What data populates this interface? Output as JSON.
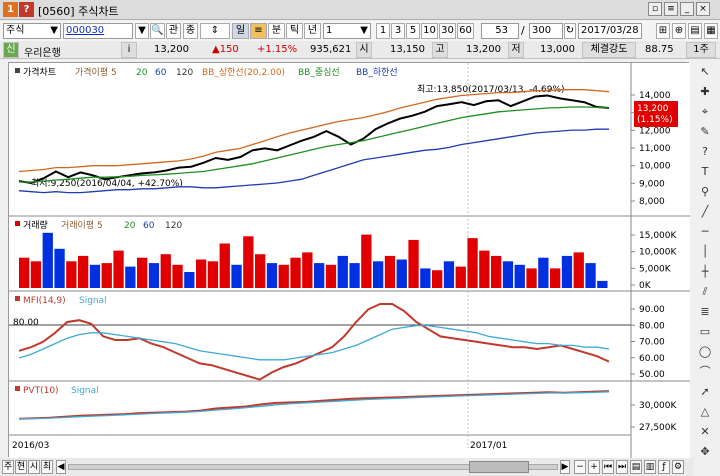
{
  "window": {
    "title": "[0560] 주식차트",
    "icons": {
      "num1": "1",
      "num2": "?"
    }
  },
  "toolbar": {
    "market": "주식",
    "code": "000030",
    "buttons": [
      "관",
      "종"
    ],
    "period_buttons": [
      "일",
      "주",
      "월",
      "분",
      "틱",
      "년"
    ],
    "minute_value": "1",
    "intervals": [
      "1",
      "3",
      "5",
      "10",
      "30",
      "60"
    ],
    "count_value": "53",
    "total_value": "300",
    "date_value": "2017/03/28"
  },
  "quote": {
    "badge": "신",
    "name": "우리은행",
    "info_icon": "i",
    "price": "13,200",
    "change": "▲150",
    "change_pct": "+1.15%",
    "volume": "935,621",
    "open_label": "시",
    "open": "13,150",
    "high_label": "고",
    "high": "13,200",
    "low_label": "저",
    "low": "13,000",
    "strength_label": "체결강도",
    "strength": "88.75",
    "unit": "1주"
  },
  "price_panel": {
    "legend": [
      "가격차트",
      "가격이평 5",
      "20",
      "60",
      "120",
      "BB_상한선(20,2.00)",
      "BB_중심선",
      "BB_하한선"
    ],
    "max_label": "최고:13,850(2017/03/13, -4.69%)",
    "min_label": "최저:9,250(2016/04/04, +42.70%)",
    "current_price": "13,200",
    "current_pct": "(1.15%)",
    "y_ticks": [
      "14,000",
      "13,000",
      "12,000",
      "11,000",
      "10,000",
      "9,000",
      "8,000"
    ]
  },
  "volume_panel": {
    "legend": [
      "거래량",
      "거래이평 5",
      "20",
      "60",
      "120"
    ],
    "y_ticks": [
      "15,000K",
      "10,000K",
      "5,000K",
      "0K"
    ]
  },
  "mfi_panel": {
    "legend": [
      "MFI(14,9)",
      "Signal"
    ],
    "level_label": "80.00",
    "y_ticks": [
      "90.00",
      "80.00",
      "70.00",
      "60.00",
      "50.00"
    ]
  },
  "pvt_panel": {
    "legend": [
      "PVT(10)",
      "Signal"
    ],
    "y_ticks": [
      "30,000K",
      "27,500K"
    ]
  },
  "x_axis": {
    "labels": [
      "2016/03",
      "2017/01"
    ]
  },
  "bottom": {
    "tabs": [
      "주",
      "현",
      "시",
      "최"
    ]
  },
  "colors": {
    "price_black": "#000000",
    "ma5": "#8b5a2b",
    "ma20": "#1f8f1f",
    "bb_upper": "#d2691e",
    "bb_lower": "#1e3cb4",
    "up": "#e00000",
    "down": "#0030e0",
    "mfi": "#c0392b",
    "signal": "#3fa9d6"
  },
  "chart_data": [
    {
      "type": "line",
      "title": "가격차트",
      "ylim": [
        8000,
        14500
      ],
      "series": [
        {
          "name": "가격차트",
          "values": [
            9400,
            9300,
            9550,
            9900,
            9600,
            9850,
            9700,
            9500,
            9600,
            9700,
            9800,
            9850,
            9950,
            10100,
            10150,
            10350,
            10600,
            10500,
            10650,
            11000,
            11100,
            11000,
            11250,
            11500,
            11700,
            12000,
            11700,
            11300,
            11600,
            12100,
            12400,
            12650,
            12800,
            13000,
            13300,
            13400,
            13500,
            13350,
            13550,
            13600,
            13300,
            13550,
            13800,
            13850,
            13700,
            13600,
            13500,
            13250,
            13200
          ]
        },
        {
          "name": "20",
          "values": [
            9350,
            9350,
            9400,
            9450,
            9500,
            9550,
            9600,
            9600,
            9620,
            9650,
            9700,
            9720,
            9760,
            9800,
            9850,
            9900,
            10000,
            10100,
            10200,
            10300,
            10450,
            10600,
            10750,
            10900,
            11050,
            11200,
            11300,
            11400,
            11500,
            11650,
            11800,
            11950,
            12100,
            12250,
            12400,
            12550,
            12700,
            12800,
            12900,
            13000,
            13050,
            13100,
            13150,
            13200,
            13220,
            13250,
            13250,
            13230,
            13200
          ]
        },
        {
          "name": "BB_상한선(20,2.00)",
          "values": [
            9900,
            9950,
            10000,
            10100,
            10100,
            10150,
            10200,
            10200,
            10200,
            10250,
            10300,
            10350,
            10400,
            10450,
            10550,
            10700,
            10900,
            11000,
            11100,
            11300,
            11500,
            11700,
            11900,
            12050,
            12200,
            12350,
            12500,
            12600,
            12700,
            12850,
            13000,
            13200,
            13350,
            13500,
            13650,
            13750,
            13850,
            13900,
            13950,
            14000,
            14000,
            14050,
            14100,
            14100,
            14150,
            14150,
            14150,
            14100,
            14050
          ]
        },
        {
          "name": "BB_하한선",
          "values": [
            8900,
            8850,
            8800,
            8850,
            8800,
            8800,
            8850,
            8900,
            8950,
            8950,
            9000,
            9000,
            9050,
            9100,
            9100,
            9050,
            9050,
            9100,
            9150,
            9200,
            9250,
            9300,
            9400,
            9500,
            9700,
            9900,
            10100,
            10300,
            10500,
            10600,
            10700,
            10800,
            10900,
            11000,
            11050,
            11150,
            11300,
            11400,
            11500,
            11600,
            11700,
            11800,
            11900,
            11950,
            12000,
            12050,
            12050,
            12100,
            12100
          ]
        }
      ]
    },
    {
      "type": "bar",
      "title": "거래량",
      "ylim": [
        0,
        16000
      ],
      "values": [
        8500,
        7500,
        15500,
        11000,
        7500,
        9000,
        6500,
        7000,
        10500,
        6000,
        8500,
        7000,
        9500,
        6500,
        4500,
        8000,
        7500,
        12500,
        6500,
        14500,
        9500,
        7000,
        6500,
        8500,
        10000,
        7000,
        6500,
        9000,
        7000,
        15000,
        7500,
        9000,
        8000,
        13500,
        5500,
        5000,
        7500,
        6000,
        14000,
        10500,
        9000,
        7500,
        6500,
        5500,
        8500,
        5500,
        9000,
        10000,
        7000,
        2000
      ],
      "colors": [
        "up",
        "up",
        "down",
        "down",
        "up",
        "up",
        "down",
        "up",
        "up",
        "down",
        "up",
        "down",
        "up",
        "up",
        "down",
        "up",
        "up",
        "up",
        "down",
        "up",
        "up",
        "down",
        "up",
        "up",
        "up",
        "down",
        "up",
        "down",
        "down",
        "up",
        "down",
        "up",
        "down",
        "up",
        "down",
        "up",
        "down",
        "up",
        "up",
        "up",
        "up",
        "down",
        "down",
        "up",
        "down",
        "up",
        "down",
        "up",
        "down",
        "down"
      ]
    },
    {
      "type": "line",
      "title": "MFI(14,9)",
      "ylim": [
        45,
        95
      ],
      "series": [
        {
          "name": "MFI(14,9)",
          "values": [
            64,
            66,
            69,
            74,
            80,
            81,
            79,
            72,
            70,
            70,
            71,
            68,
            66,
            63,
            60,
            57,
            56,
            54,
            52,
            50,
            48,
            52,
            55,
            57,
            60,
            63,
            66,
            72,
            80,
            87,
            90,
            90,
            86,
            80,
            76,
            72,
            71,
            70,
            69,
            68,
            67,
            66,
            66,
            65,
            66,
            67,
            65,
            63,
            61,
            58
          ]
        },
        {
          "name": "Signal",
          "values": [
            60,
            62,
            65,
            68,
            71,
            73,
            74,
            74,
            73,
            72,
            71,
            70,
            69,
            68,
            66,
            64,
            63,
            62,
            61,
            60,
            59,
            59,
            59,
            60,
            61,
            62,
            63,
            65,
            67,
            70,
            73,
            76,
            77,
            78,
            78,
            77,
            76,
            75,
            74,
            72,
            71,
            70,
            69,
            68,
            68,
            67,
            67,
            66,
            66,
            65
          ]
        }
      ]
    },
    {
      "type": "line",
      "title": "PVT(10)",
      "ylim": [
        26500,
        31000
      ],
      "series": [
        {
          "name": "PVT(10)",
          "values": [
            27700,
            27750,
            27800,
            27900,
            28000,
            28050,
            28100,
            28150,
            28250,
            28300,
            28350,
            28400,
            28500,
            28700,
            28800,
            28900,
            29100,
            29250,
            29300,
            29350,
            29450,
            29550,
            29650,
            29700,
            29750,
            29800,
            29850,
            29900,
            29950,
            30000,
            30050,
            30100,
            30150,
            30200,
            30250,
            30300,
            30250,
            30300,
            30350,
            30400
          ]
        },
        {
          "name": "Signal",
          "values": [
            27700,
            27720,
            27760,
            27820,
            27900,
            27960,
            28020,
            28080,
            28150,
            28220,
            28280,
            28340,
            28420,
            28540,
            28650,
            28780,
            28920,
            29060,
            29180,
            29260,
            29340,
            29420,
            29500,
            29580,
            29640,
            29700,
            29760,
            29820,
            29870,
            29920,
            29970,
            30020,
            30070,
            30120,
            30170,
            30220,
            30230,
            30250,
            30290,
            30330
          ]
        }
      ]
    }
  ]
}
